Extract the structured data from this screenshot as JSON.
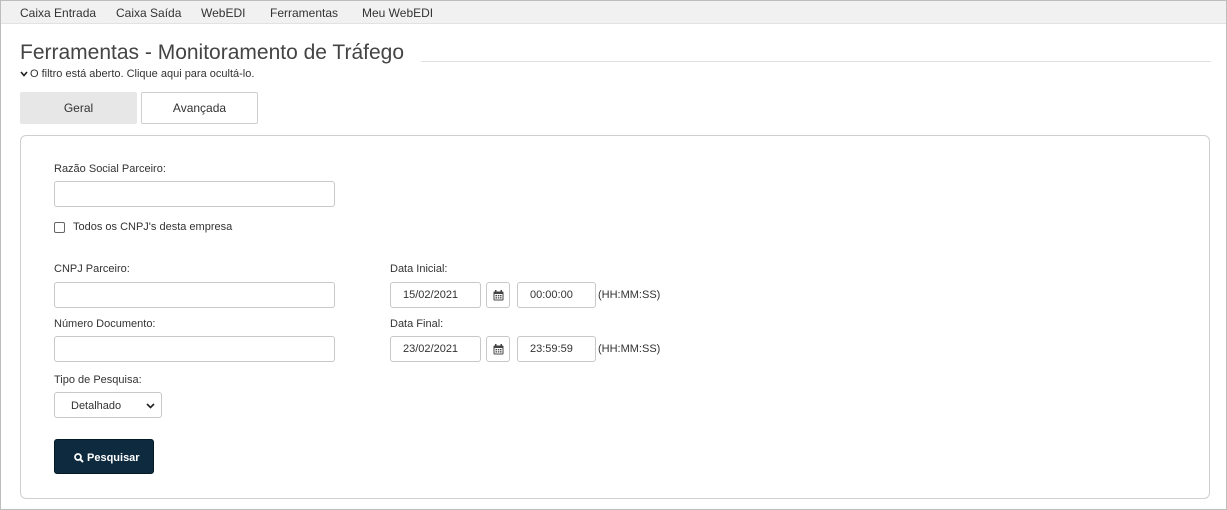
{
  "nav": {
    "items": [
      "Caixa Entrada",
      "Caixa Saída",
      "WebEDI",
      "Ferramentas",
      "Meu WebEDI"
    ]
  },
  "page": {
    "title": "Ferramentas - Monitoramento de Tráfego",
    "filter_toggle": "O filtro está aberto. Clique aqui para ocultá-lo."
  },
  "tabs": [
    {
      "label": "Geral",
      "active": true
    },
    {
      "label": "Avançada",
      "active": false
    }
  ],
  "form": {
    "razao_social": {
      "label": "Razão Social Parceiro:",
      "value": ""
    },
    "todos_cnpj": {
      "label": "Todos os CNPJ's desta empresa",
      "checked": false
    },
    "cnpj_parceiro": {
      "label": "CNPJ Parceiro:",
      "value": ""
    },
    "numero_documento": {
      "label": "Número Documento:",
      "value": ""
    },
    "tipo_pesquisa": {
      "label": "Tipo de Pesquisa:",
      "value": "Detalhado"
    },
    "data_inicial": {
      "label": "Data Inicial:",
      "date": "15/02/2021",
      "time": "00:00:00",
      "hint": "(HH:MM:SS)"
    },
    "data_final": {
      "label": "Data Final:",
      "date": "23/02/2021",
      "time": "23:59:59",
      "hint": "(HH:MM:SS)"
    },
    "search_button": "Pesquisar"
  },
  "icons": {
    "calendar": "calendar-icon",
    "search": "search-icon",
    "chevron_down": "chevron-down-icon"
  },
  "colors": {
    "button_bg": "#0d2a3f",
    "active_tab_bg": "#e7e7e7",
    "nav_bg": "#f1f1f1"
  }
}
